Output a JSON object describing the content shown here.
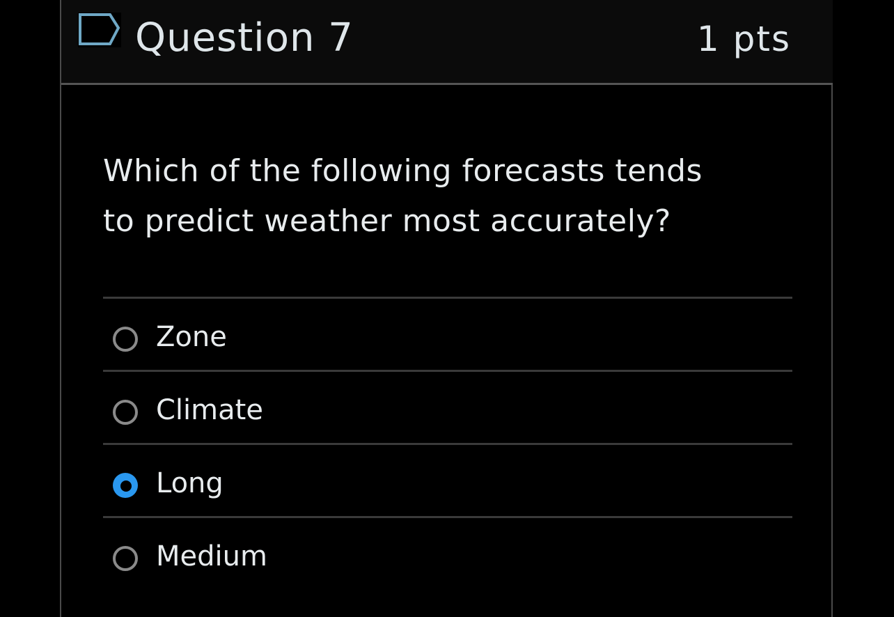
{
  "question": {
    "title": "Question 7",
    "points": "1 pts",
    "flag_icon": "flag-outline-icon",
    "text": "Which of the following forecasts tends to predict weather most accurately?"
  },
  "answers": [
    {
      "label": "Zone",
      "selected": false
    },
    {
      "label": "Climate",
      "selected": false
    },
    {
      "label": "Long",
      "selected": true
    },
    {
      "label": "Medium",
      "selected": false
    }
  ],
  "colors": {
    "background": "#000000",
    "header_background": "#0b0b0b",
    "text": "#e8ecee",
    "selected_radio": "#2a98f0",
    "flag_outline": "#6fa8c6",
    "divider": "#3a3a3a"
  }
}
